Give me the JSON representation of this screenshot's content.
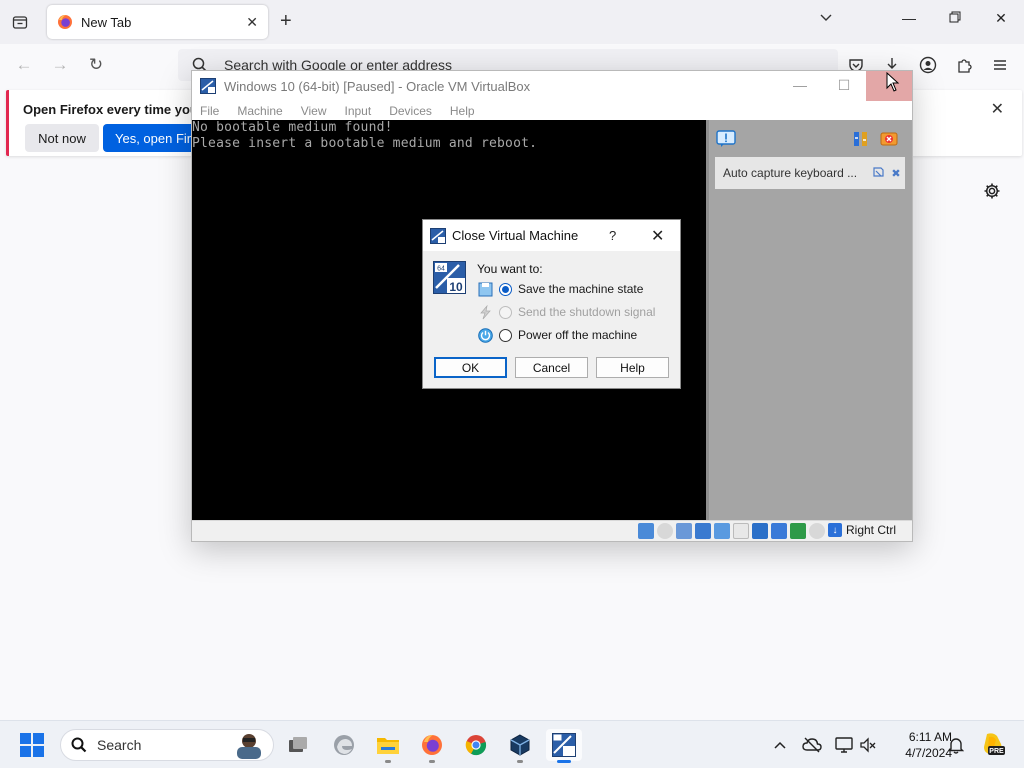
{
  "browser": {
    "tab_title": "New Tab",
    "urlbar_placeholder": "Search with Google or enter address",
    "notice_message": "Open Firefox every time you re",
    "notice_not_now": "Not now",
    "notice_yes": "Yes, open Firefo",
    "accent": "#0061e0"
  },
  "vbox": {
    "title": "Windows 10 (64-bit) [Paused] - Oracle VM VirtualBox",
    "menus": [
      "File",
      "Machine",
      "View",
      "Input",
      "Devices",
      "Help"
    ],
    "console_lines": [
      "No bootable medium found!",
      "Please insert a bootable medium and reboot."
    ],
    "notification": "Auto capture keyboard ...",
    "host_key": "Right Ctrl"
  },
  "dialog": {
    "title": "Close Virtual Machine",
    "help_glyph": "?",
    "prompt": "You want to:",
    "options": [
      {
        "label": "Save the machine state",
        "selected": true,
        "enabled": true
      },
      {
        "label": "Send the shutdown signal",
        "selected": false,
        "enabled": false
      },
      {
        "label": "Power off the machine",
        "selected": false,
        "enabled": true
      }
    ],
    "buttons": {
      "ok": "OK",
      "cancel": "Cancel",
      "help": "Help"
    },
    "logo_top": "64",
    "logo_bottom": "10"
  },
  "taskbar": {
    "search_label": "Search",
    "time": "6:11 AM",
    "date": "4/7/2024",
    "apps": [
      "task-view-icon",
      "edge-icon",
      "file-explorer-icon",
      "firefox-icon",
      "chrome-icon",
      "virtualbox-icon",
      "vm-windows10-icon"
    ],
    "copilot_badge": "PRE"
  }
}
